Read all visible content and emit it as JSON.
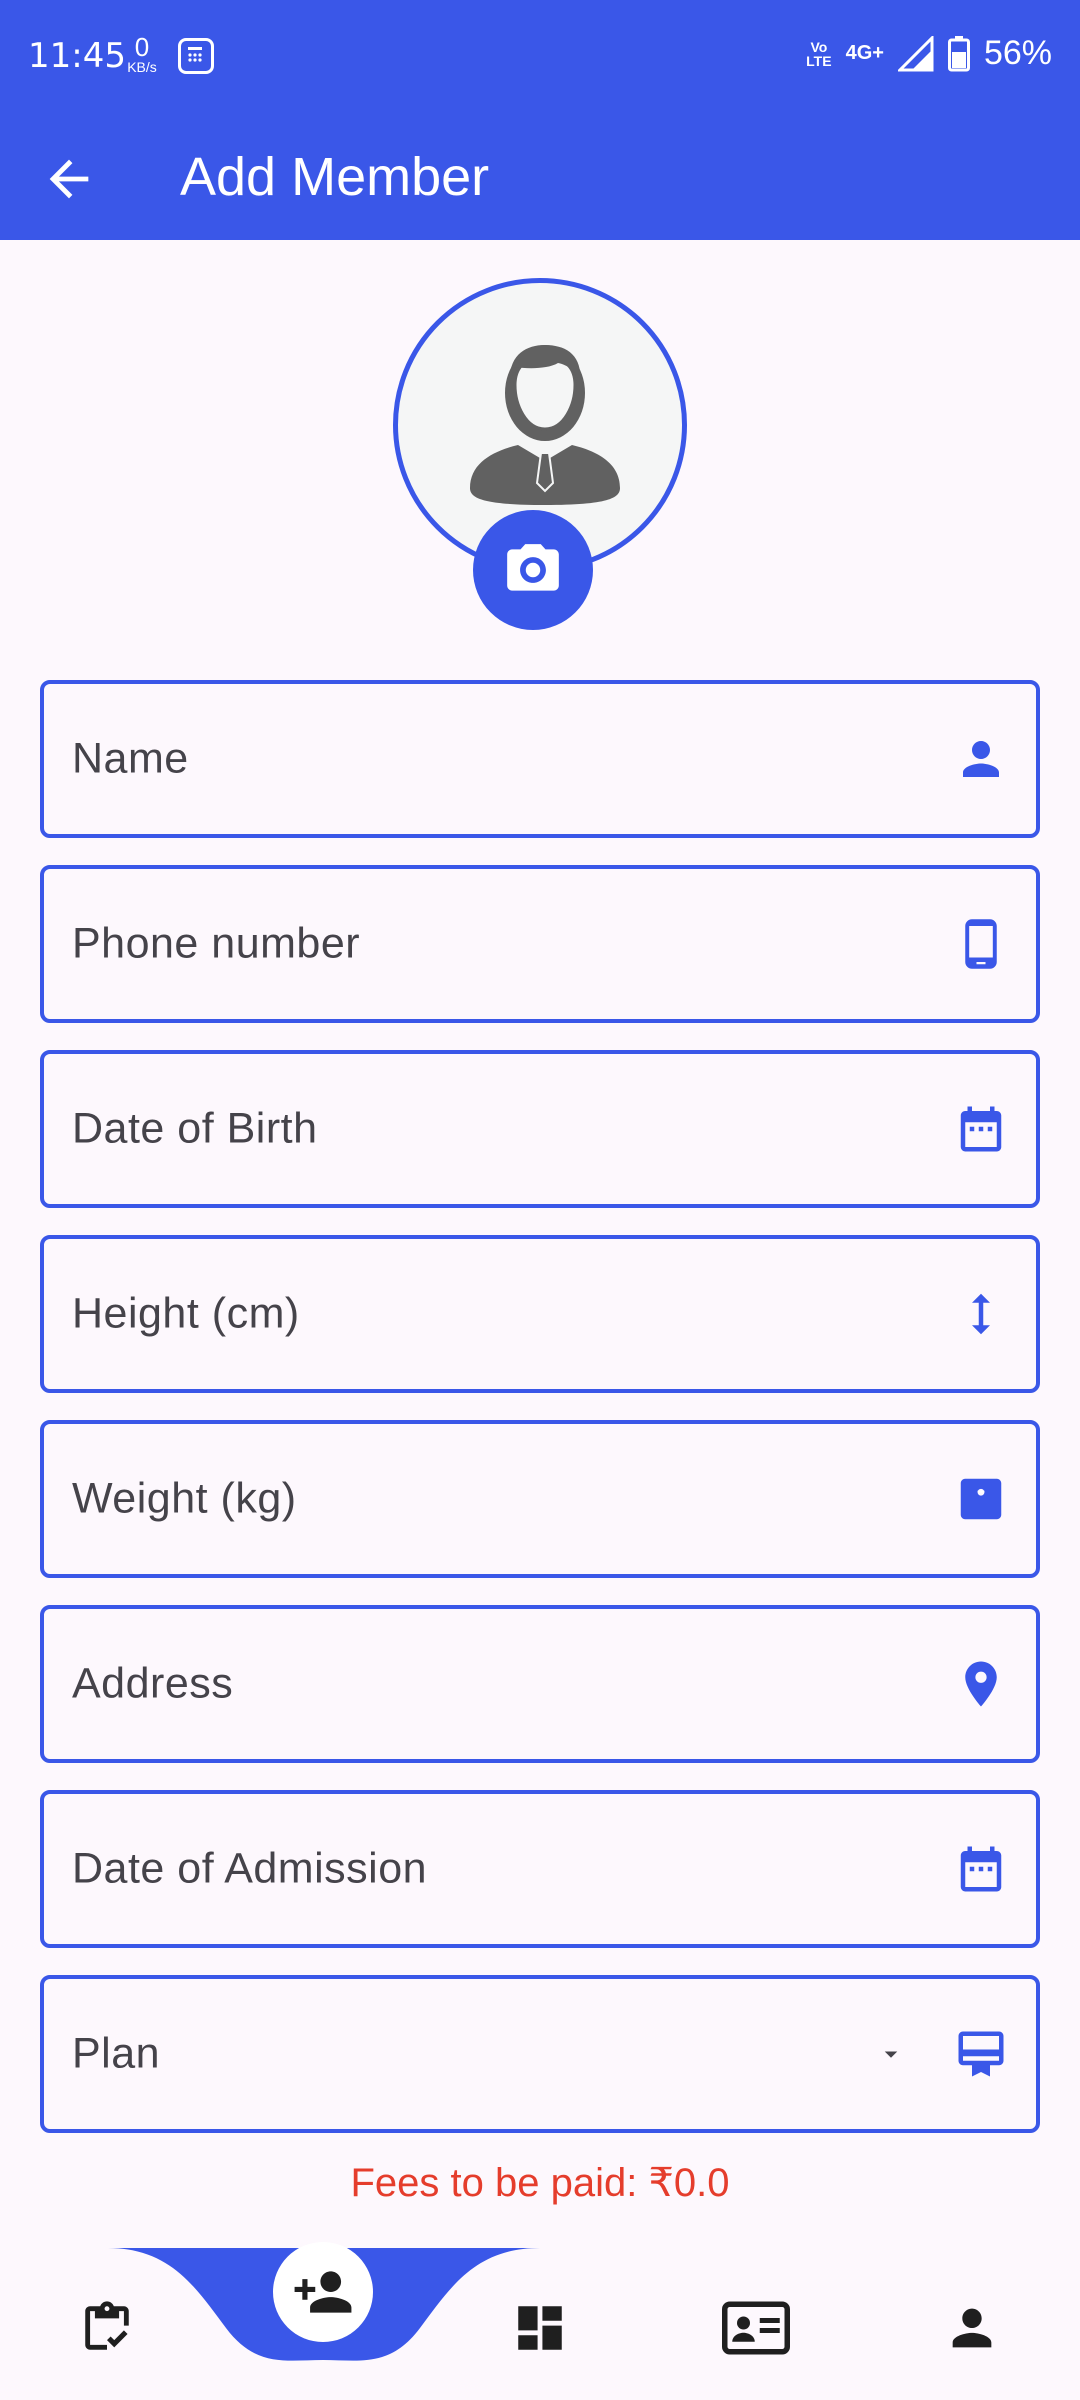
{
  "status_bar": {
    "time": "11:45",
    "net_speed_value": "0",
    "net_speed_unit": "KB/s",
    "volte_top": "Vo",
    "volte_bottom": "LTE",
    "network": "4G+",
    "battery": "56%"
  },
  "app_bar": {
    "title": "Add Member",
    "back_icon": "arrow-back-icon"
  },
  "avatar": {
    "icon": "user-avatar-icon",
    "camera_icon": "camera-icon"
  },
  "form": {
    "fields": [
      {
        "label": "Name",
        "icon": "person-icon"
      },
      {
        "label": "Phone number",
        "icon": "phone-icon"
      },
      {
        "label": "Date of Birth",
        "icon": "calendar-icon"
      },
      {
        "label": "Height (cm)",
        "icon": "height-icon"
      },
      {
        "label": "Weight (kg)",
        "icon": "scale-icon"
      },
      {
        "label": "Address",
        "icon": "location-icon"
      },
      {
        "label": "Date of Admission",
        "icon": "calendar-icon"
      },
      {
        "label": "Plan",
        "icon": "card-membership-icon",
        "dropdown": true
      }
    ]
  },
  "fees_text": "Fees to be paid: ₹0.0",
  "bottom_nav": {
    "items": [
      {
        "name": "attendance",
        "icon": "clipboard-check-icon"
      },
      {
        "name": "add-member",
        "icon": "person-add-icon",
        "active": true
      },
      {
        "name": "dashboard",
        "icon": "dashboard-icon"
      },
      {
        "name": "members",
        "icon": "id-card-icon"
      },
      {
        "name": "profile",
        "icon": "person-icon"
      }
    ]
  },
  "colors": {
    "primary": "#3a57e8",
    "background": "#fdf8fd",
    "fees_text": "#e53d2c",
    "label_text": "#45434a"
  }
}
